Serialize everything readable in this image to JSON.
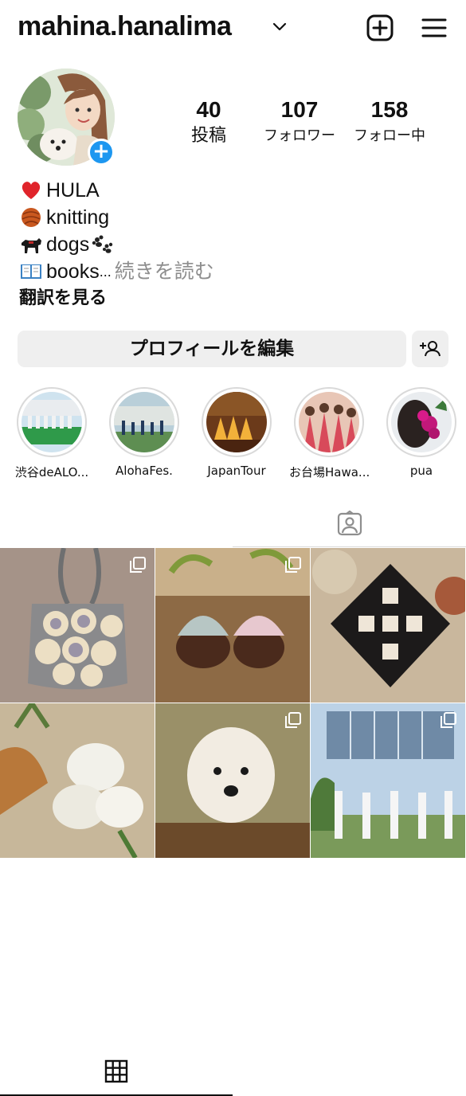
{
  "header": {
    "username": "mahina.hanalima"
  },
  "stats": {
    "posts": {
      "count": "40",
      "label": "投稿"
    },
    "followers": {
      "count": "107",
      "label": "フォロワー"
    },
    "following": {
      "count": "158",
      "label": "フォロー中"
    }
  },
  "bio": {
    "lines": [
      "HULA",
      "knitting",
      "dogs",
      "books"
    ],
    "truncation": "...",
    "read_more": "続きを読む",
    "translate": "翻訳を見る"
  },
  "actions": {
    "edit_profile": "プロフィールを編集"
  },
  "highlights": [
    {
      "label": "渋谷deALO..."
    },
    {
      "label": "AlohaFes."
    },
    {
      "label": "JapanTour"
    },
    {
      "label": "お台場Hawa..."
    },
    {
      "label": "pua"
    }
  ],
  "tabs": [
    {
      "icon": "grid-icon",
      "active": true
    },
    {
      "icon": "tagged-person-icon",
      "active": false
    }
  ],
  "posts": [
    {
      "subject": "crochet bag",
      "multi": true
    },
    {
      "subject": "crochet acorns",
      "multi": true
    },
    {
      "subject": "crochet doily",
      "multi": false
    },
    {
      "subject": "white flowers",
      "multi": false
    },
    {
      "subject": "poodle",
      "multi": true
    },
    {
      "subject": "hula dancers",
      "multi": true
    }
  ],
  "colors": {
    "accent": "#1d97f0",
    "button_bg": "#efefef",
    "muted_text": "#8e8e8e"
  }
}
